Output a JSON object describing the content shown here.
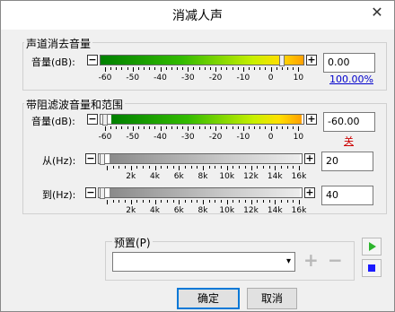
{
  "window": {
    "title": "消减人声"
  },
  "channel_group": {
    "title": "声道消去音量",
    "volume_label": "音量(dB):",
    "volume_value": "0.00",
    "percent_link": "100.00%",
    "level": 0.905,
    "ticks": [
      "-60",
      "-50",
      "-40",
      "-30",
      "-20",
      "-10",
      "0",
      "10"
    ]
  },
  "band_group": {
    "title": "带阻滤波音量和范围",
    "volume_label": "音量(dB):",
    "volume_value": "-60.00",
    "off_link": "关",
    "level": 0.01,
    "ticks": [
      "-60",
      "-50",
      "-40",
      "-30",
      "-20",
      "-10",
      "0",
      "10"
    ],
    "from_label": "从(Hz):",
    "from_value": "20",
    "to_label": "到(Hz):",
    "to_value": "40",
    "hz_ticks": [
      "2k",
      "4k",
      "6k",
      "8k",
      "10k",
      "12k",
      "14k",
      "16k"
    ]
  },
  "preset": {
    "label": "预置(P)",
    "selected": ""
  },
  "buttons": {
    "ok": "确定",
    "cancel": "取消"
  },
  "icons": {
    "play_color": "#2db52d",
    "stop_color": "#1a1aff"
  }
}
